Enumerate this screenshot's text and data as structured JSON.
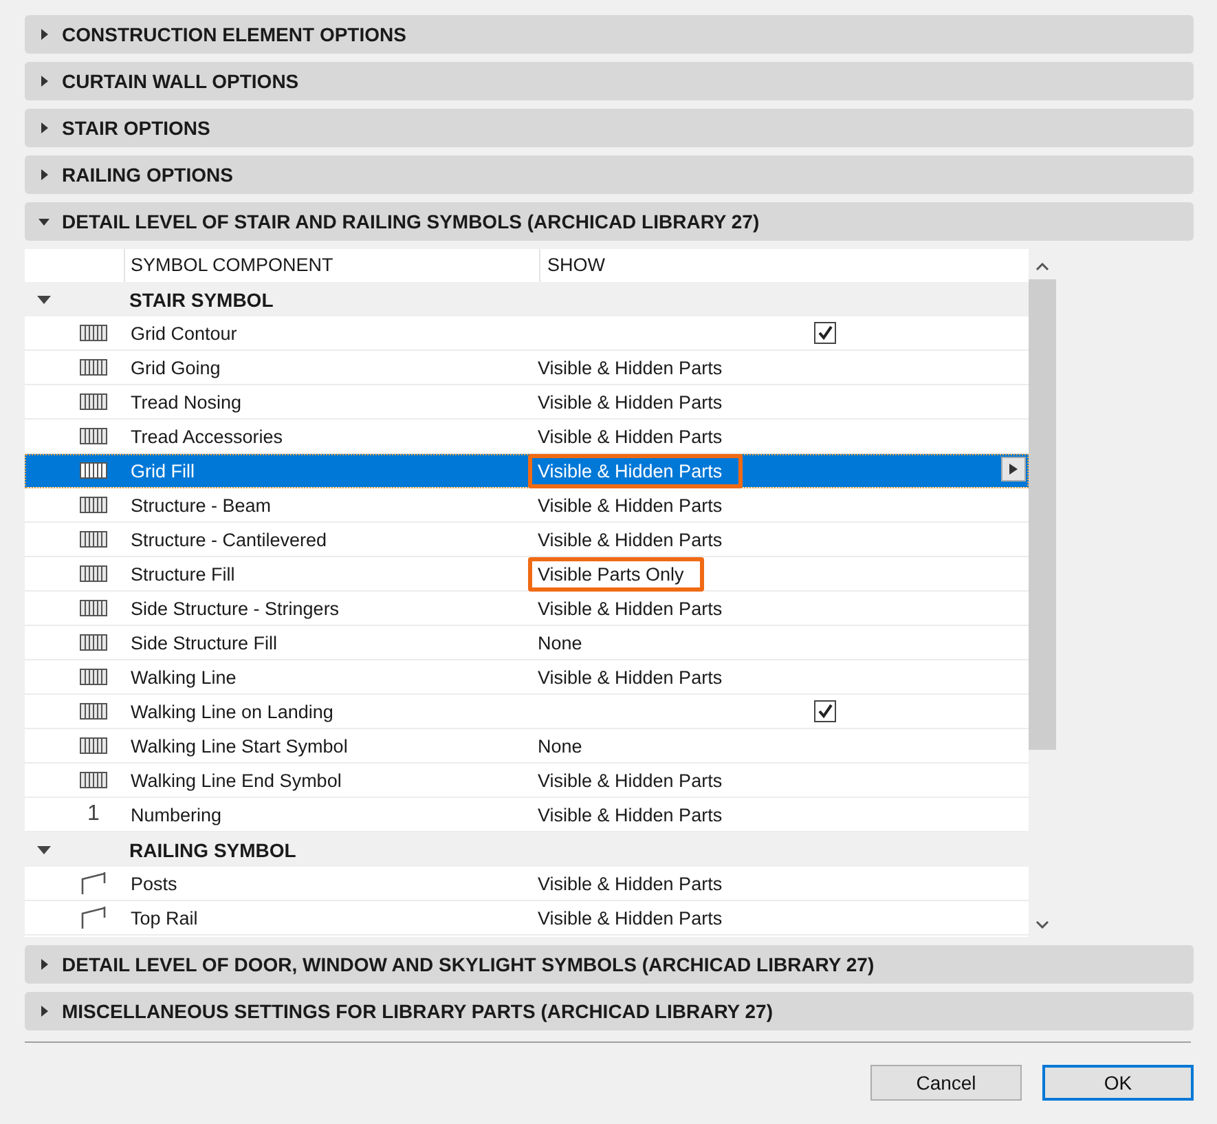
{
  "sections_top": [
    {
      "title": "CONSTRUCTION ELEMENT OPTIONS",
      "expanded": false
    },
    {
      "title": "CURTAIN WALL OPTIONS",
      "expanded": false
    },
    {
      "title": "STAIR OPTIONS",
      "expanded": false
    },
    {
      "title": "RAILING OPTIONS",
      "expanded": false
    },
    {
      "title": "DETAIL LEVEL OF STAIR AND RAILING SYMBOLS (ARCHICAD LIBRARY 27)",
      "expanded": true
    }
  ],
  "table": {
    "columns": [
      "SYMBOL COMPONENT",
      "SHOW"
    ],
    "groups": [
      {
        "title": "STAIR SYMBOL",
        "kind": "stair",
        "expanded": true,
        "rows": [
          {
            "name": "Grid Contour",
            "kind": "checkbox",
            "checked": true,
            "selected": false
          },
          {
            "name": "Grid Going",
            "kind": "value",
            "value": "Visible & Hidden Parts",
            "selected": false,
            "highlighted": false
          },
          {
            "name": "Tread Nosing",
            "kind": "value",
            "value": "Visible & Hidden Parts",
            "selected": false,
            "highlighted": false
          },
          {
            "name": "Tread Accessories",
            "kind": "value",
            "value": "Visible & Hidden Parts",
            "selected": false,
            "highlighted": false
          },
          {
            "name": "Grid Fill",
            "kind": "value",
            "value": "Visible & Hidden Parts",
            "selected": true,
            "highlighted": true
          },
          {
            "name": "Structure - Beam",
            "kind": "value",
            "value": "Visible & Hidden Parts",
            "selected": false,
            "highlighted": false
          },
          {
            "name": "Structure - Cantilevered",
            "kind": "value",
            "value": "Visible & Hidden Parts",
            "selected": false,
            "highlighted": false
          },
          {
            "name": "Structure Fill",
            "kind": "value",
            "value": "Visible Parts Only",
            "selected": false,
            "highlighted": true
          },
          {
            "name": "Side Structure - Stringers",
            "kind": "value",
            "value": "Visible & Hidden Parts",
            "selected": false,
            "highlighted": false
          },
          {
            "name": "Side Structure Fill",
            "kind": "value",
            "value": "None",
            "selected": false,
            "highlighted": false
          },
          {
            "name": "Walking Line",
            "kind": "value",
            "value": "Visible & Hidden Parts",
            "selected": false,
            "highlighted": false
          },
          {
            "name": "Walking Line on Landing",
            "kind": "checkbox",
            "checked": true,
            "selected": false
          },
          {
            "name": "Walking Line Start Symbol",
            "kind": "value",
            "value": "None",
            "selected": false,
            "highlighted": false
          },
          {
            "name": "Walking Line End Symbol",
            "kind": "value",
            "value": "Visible & Hidden Parts",
            "selected": false,
            "highlighted": false
          },
          {
            "name": "Numbering",
            "kind": "value",
            "icon_text": "1",
            "value": "Visible & Hidden Parts",
            "selected": false,
            "highlighted": false
          }
        ]
      },
      {
        "title": "RAILING SYMBOL",
        "kind": "railing",
        "expanded": true,
        "rows": [
          {
            "name": "Posts",
            "kind": "value",
            "value": "Visible & Hidden Parts",
            "selected": false,
            "highlighted": false
          },
          {
            "name": "Top Rail",
            "kind": "value",
            "value": "Visible & Hidden Parts",
            "selected": false,
            "highlighted": false
          }
        ]
      }
    ]
  },
  "sections_bottom": [
    {
      "title": "DETAIL LEVEL OF DOOR, WINDOW AND SKYLIGHT SYMBOLS (ARCHICAD LIBRARY 27)",
      "expanded": false
    },
    {
      "title": "MISCELLANEOUS SETTINGS FOR LIBRARY PARTS (ARCHICAD LIBRARY 27)",
      "expanded": false
    }
  ],
  "buttons": [
    {
      "label": "Cancel",
      "kind": "secondary"
    },
    {
      "label": "OK",
      "kind": "default"
    }
  ]
}
